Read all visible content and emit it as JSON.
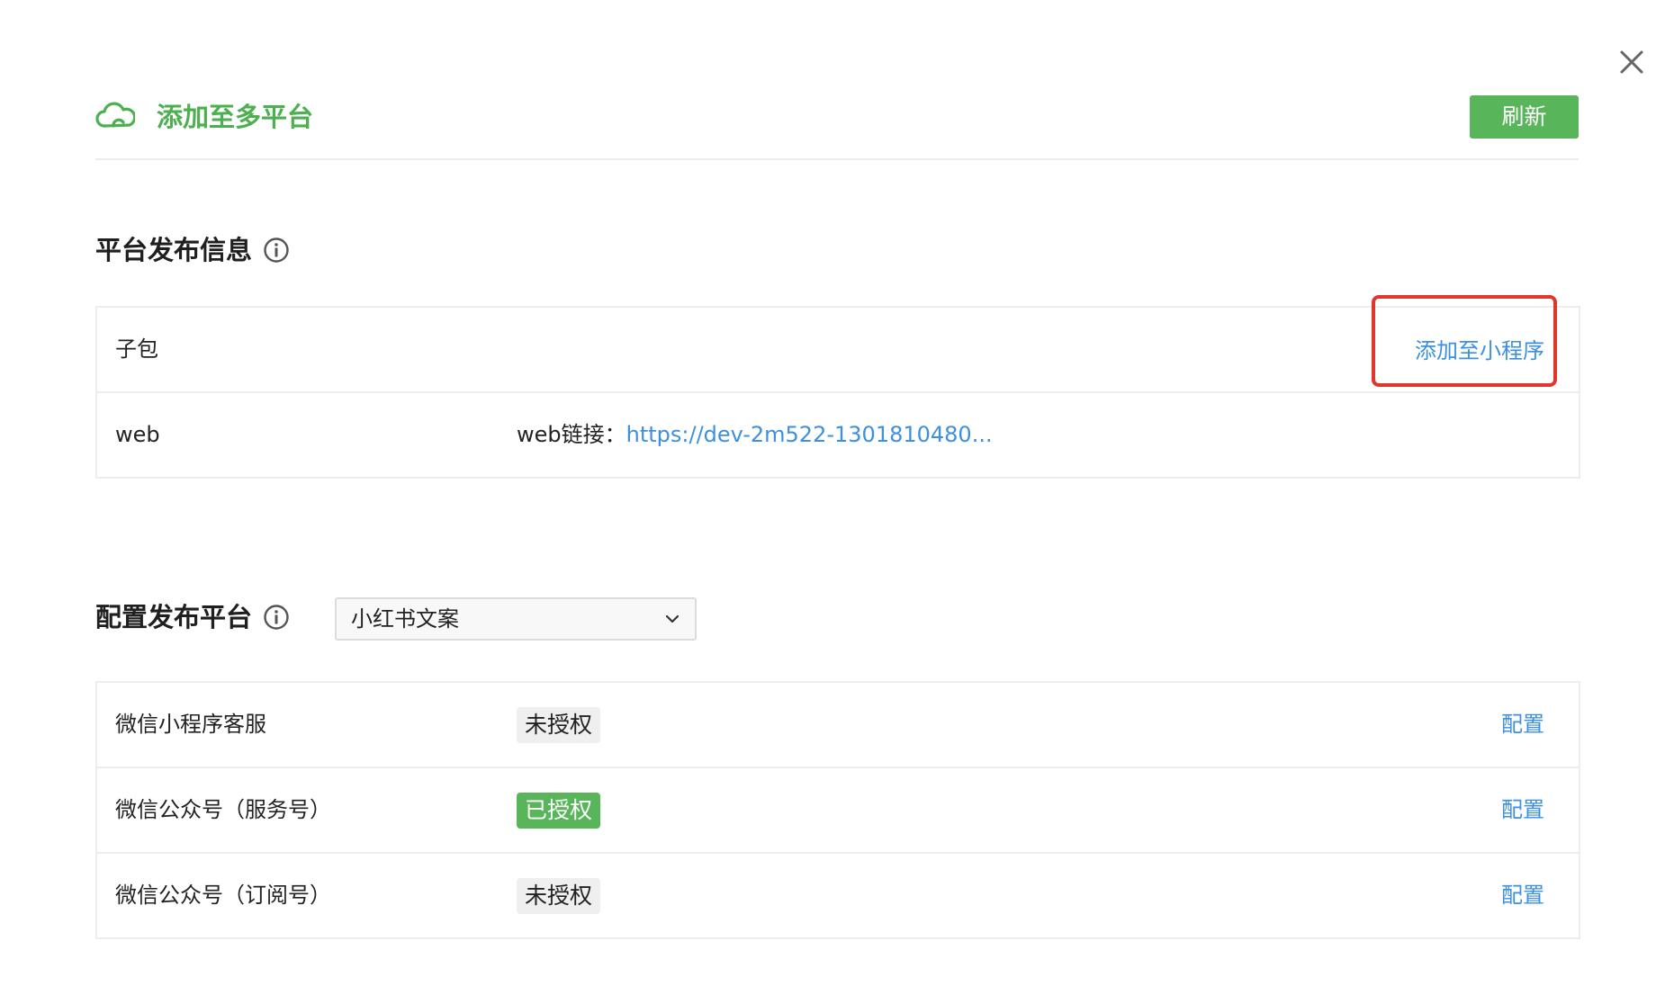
{
  "header": {
    "title": "添加至多平台",
    "refresh_label": "刷新",
    "icon": "cloud-icon",
    "accent_color": "#4caf50"
  },
  "close": {
    "icon": "close-icon"
  },
  "publish_info": {
    "title": "平台发布信息",
    "info_icon": "info-icon",
    "rows": [
      {
        "name": "子包",
        "action_label": "添加至小程序"
      },
      {
        "name": "web",
        "link_label": "web链接：",
        "link_value": "https://dev-2m522-1301810480..."
      }
    ]
  },
  "config_platform": {
    "title": "配置发布平台",
    "info_icon": "info-icon",
    "select": {
      "value": "小红书文案"
    },
    "rows": [
      {
        "name": "微信小程序客服",
        "status": "未授权",
        "authorized": false,
        "action_label": "配置"
      },
      {
        "name": "微信公众号（服务号）",
        "status": "已授权",
        "authorized": true,
        "action_label": "配置"
      },
      {
        "name": "微信公众号（订阅号）",
        "status": "未授权",
        "authorized": false,
        "action_label": "配置"
      }
    ]
  },
  "colors": {
    "link": "#3d8fe0",
    "success": "#58b55a",
    "highlight": "#e0362b"
  }
}
